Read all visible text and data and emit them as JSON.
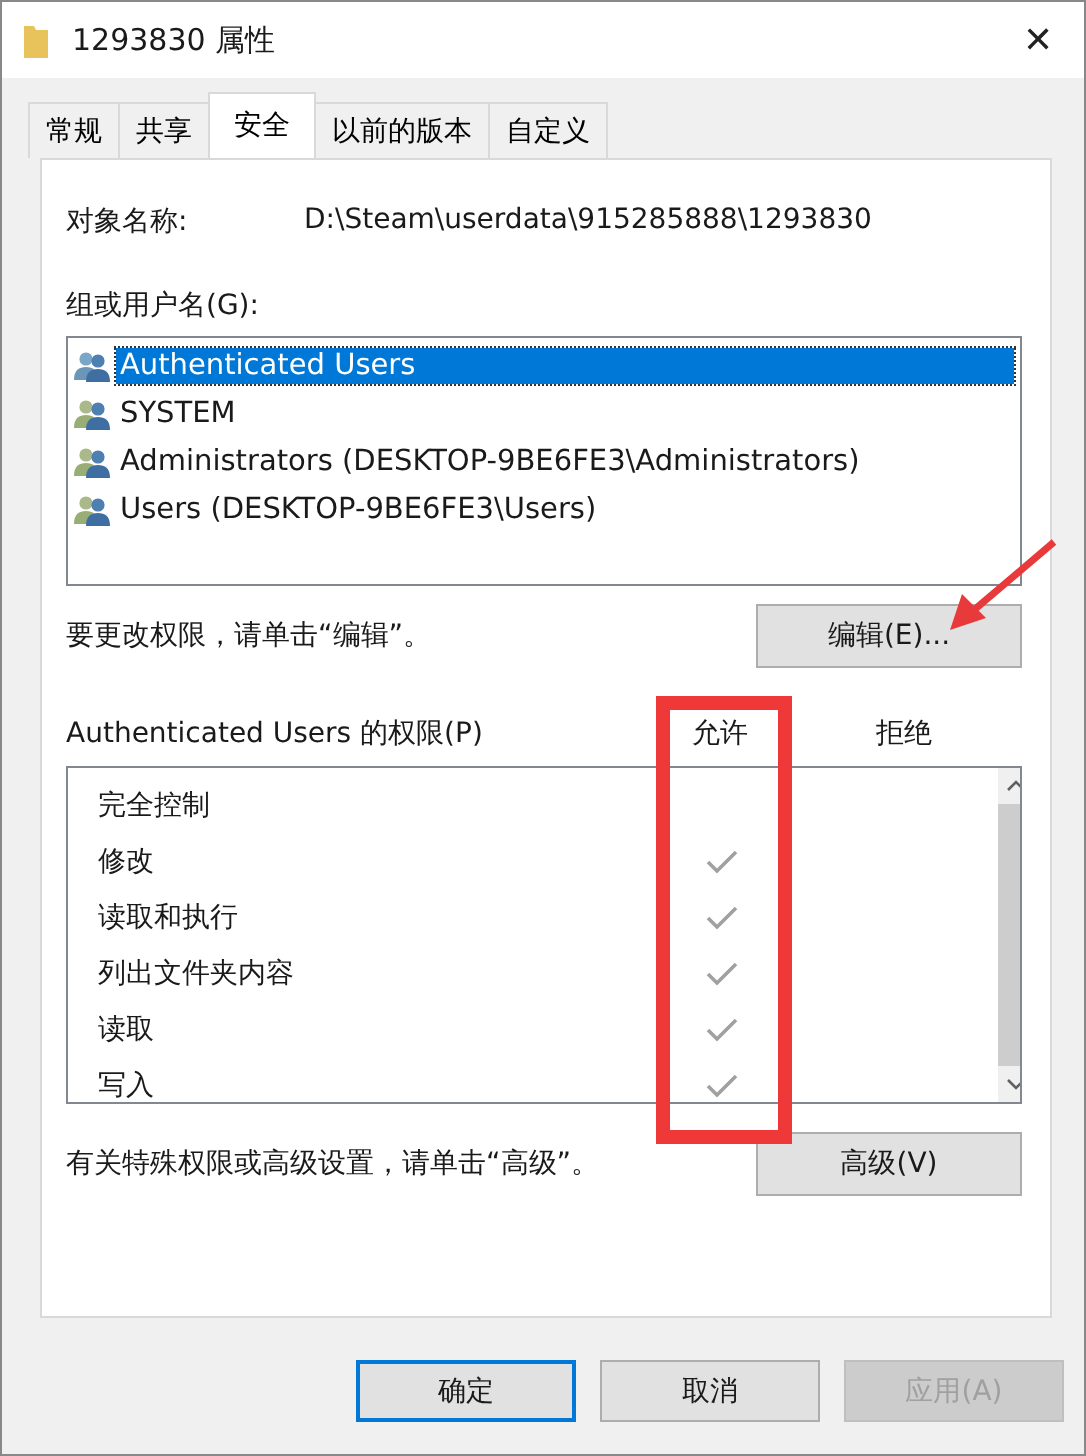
{
  "window": {
    "title": "1293830 属性",
    "close": "✕"
  },
  "tabs": [
    {
      "label": "常规",
      "selected": false
    },
    {
      "label": "共享",
      "selected": false
    },
    {
      "label": "安全",
      "selected": true
    },
    {
      "label": "以前的版本",
      "selected": false
    },
    {
      "label": "自定义",
      "selected": false
    }
  ],
  "object_name": {
    "label": "对象名称:",
    "value": "D:\\Steam\\userdata\\915285888\\1293830"
  },
  "groups": {
    "label": "组或用户名(G):",
    "items": [
      {
        "name": "Authenticated Users",
        "selected": true
      },
      {
        "name": "SYSTEM",
        "selected": false
      },
      {
        "name": "Administrators (DESKTOP-9BE6FE3\\Administrators)",
        "selected": false
      },
      {
        "name": "Users (DESKTOP-9BE6FE3\\Users)",
        "selected": false
      }
    ]
  },
  "edit_hint": "要更改权限，请单击“编辑”。",
  "edit_button": "编辑(E)...",
  "permissions": {
    "label": "Authenticated Users 的权限(P)",
    "allow_header": "允许",
    "deny_header": "拒绝",
    "rows": [
      {
        "name": "完全控制",
        "allow": false,
        "deny": false
      },
      {
        "name": "修改",
        "allow": true,
        "deny": false
      },
      {
        "name": "读取和执行",
        "allow": true,
        "deny": false
      },
      {
        "name": "列出文件夹内容",
        "allow": true,
        "deny": false
      },
      {
        "name": "读取",
        "allow": true,
        "deny": false
      },
      {
        "name": "写入",
        "allow": true,
        "deny": false
      }
    ]
  },
  "advanced_hint": "有关特殊权限或高级设置，请单击“高级”。",
  "advanced_button": "高级(V)",
  "buttons": [
    {
      "label": "确定",
      "kind": "default",
      "disabled": false
    },
    {
      "label": "取消",
      "kind": "normal",
      "disabled": false
    },
    {
      "label": "应用(A)",
      "kind": "normal",
      "disabled": true
    }
  ]
}
